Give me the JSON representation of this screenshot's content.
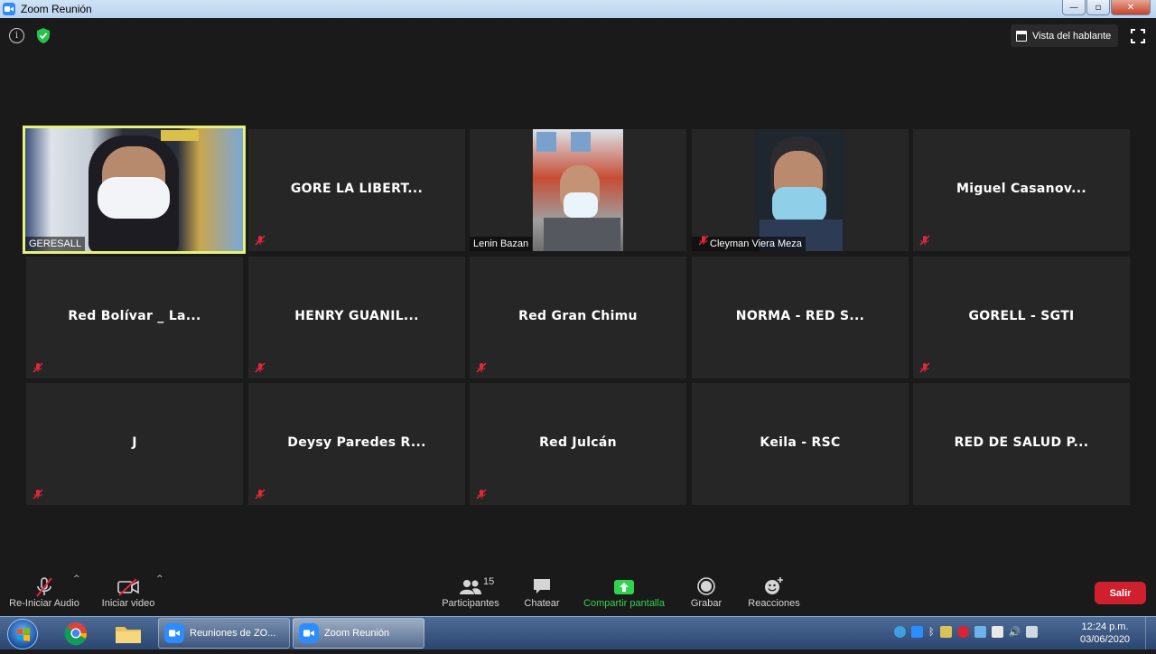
{
  "window": {
    "title": "Zoom Reunión",
    "min": "—",
    "max": "▫",
    "close": "✕"
  },
  "top": {
    "speaker_view": "Vista del hablante",
    "info": "i"
  },
  "tiles": [
    {
      "name": "GERESALL",
      "video": true
    },
    {
      "name": "GORE LA LIBERT...",
      "video": false,
      "muted": true
    },
    {
      "name": "Lenin Bazan",
      "video": true
    },
    {
      "name": "Cleyman Viera Meza",
      "video": true,
      "muted": true
    },
    {
      "name": "Miguel Casanov...",
      "video": false,
      "muted": true
    },
    {
      "name": "Red Bolívar _ La...",
      "video": false,
      "muted": true
    },
    {
      "name": "HENRY GUANIL...",
      "video": false,
      "muted": true
    },
    {
      "name": "Red Gran Chimu",
      "video": false,
      "muted": true
    },
    {
      "name": "NORMA - RED S...",
      "video": false,
      "muted": false
    },
    {
      "name": "GORELL - SGTI",
      "video": false,
      "muted": true
    },
    {
      "name": "J",
      "video": false,
      "muted": true
    },
    {
      "name": "Deysy Paredes R...",
      "video": false,
      "muted": true
    },
    {
      "name": "Red Julcán",
      "video": false,
      "muted": true
    },
    {
      "name": "Keila - RSC",
      "video": false,
      "muted": false
    },
    {
      "name": "RED DE SALUD P...",
      "video": false,
      "muted": false
    }
  ],
  "toolbar": {
    "audio": "Re-Iniciar Audio",
    "video": "Iniciar video",
    "participants": "Participantes",
    "participants_count": "15",
    "chat": "Chatear",
    "share": "Compartir pantalla",
    "record": "Grabar",
    "reactions": "Reacciones",
    "leave": "Salir"
  },
  "taskbar": {
    "win1": "Reuniones de ZO...",
    "win2": "Zoom Reunión",
    "time": "12:24 p.m.",
    "date": "03/06/2020"
  },
  "colors": {
    "active_border": "#e7f07a",
    "share_green": "#2fd34e",
    "leave_red": "#d0202d",
    "mute_red": "#e0283a"
  }
}
